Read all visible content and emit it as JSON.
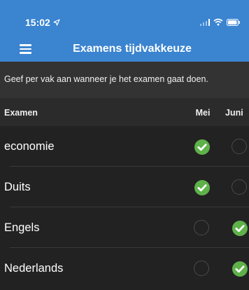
{
  "status_bar": {
    "time": "15:02"
  },
  "nav": {
    "title": "Examens tijdvakkeuze"
  },
  "subtitle": "Geef per vak aan wanneer je het examen gaat doen.",
  "table": {
    "col_exam": "Examen",
    "col_mei": "Mei",
    "col_juni": "Juni",
    "rows": [
      {
        "subject": "economie",
        "mei": true,
        "juni": false
      },
      {
        "subject": "Duits",
        "mei": true,
        "juni": false
      },
      {
        "subject": "Engels",
        "mei": false,
        "juni": true
      },
      {
        "subject": "Nederlands",
        "mei": false,
        "juni": true
      }
    ]
  },
  "colors": {
    "header_blue": "#3a84d0",
    "check_green": "#5fb14a",
    "background": "#222222"
  },
  "icons": {
    "menu": "hamburger-menu-icon",
    "check": "checkmark-circle-icon",
    "location": "location-arrow-icon"
  }
}
